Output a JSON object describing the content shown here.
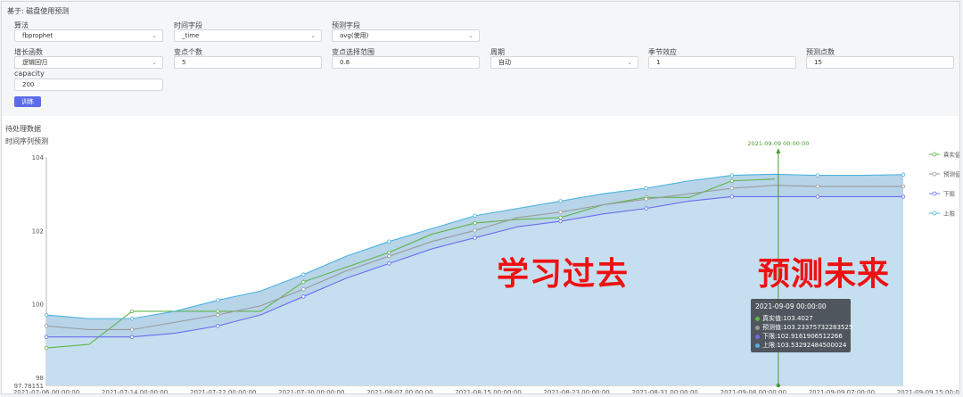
{
  "header": {
    "title": "基于: 磁盘使用预测"
  },
  "form": {
    "algo_label": "算法",
    "algo_value": "fbprophet",
    "time_label": "时间字段",
    "time_value": "_time",
    "pred_label": "预测字段",
    "pred_value": "avg(使用)",
    "growth_label": "增长函数",
    "growth_value": "逻辑回归",
    "cp_count_label": "变点个数",
    "cp_count_value": "5",
    "cp_range_label": "变点选择范围",
    "cp_range_value": "0.8",
    "period_label": "周期",
    "period_value": "自动",
    "season_label": "季节效应",
    "season_value": "1",
    "points_label": "预测点数",
    "points_value": "15",
    "capacity_label": "capacity",
    "capacity_value": "200",
    "train_button": "训练"
  },
  "section": {
    "pending": "待处理数据",
    "ts_title": "时间序列预测"
  },
  "overlay": {
    "learn": "学习过去",
    "predict": "预测未来"
  },
  "tooltip": {
    "time": "2021-09-09 00:00:00",
    "rows": [
      {
        "text": "真实值:103.4027",
        "color": "#5fb548"
      },
      {
        "text": "预测值:103.23375732283525",
        "color": "#9a9a9a"
      },
      {
        "text": "下限:102.9161906512266",
        "color": "#6b6cf0"
      },
      {
        "text": "上限:103.53292484500024",
        "color": "#4bb3e0"
      }
    ]
  },
  "chart_data": {
    "type": "line",
    "x": [
      "2021-07-06",
      "2021-07-10",
      "2021-07-14",
      "2021-07-18",
      "2021-07-22",
      "2021-07-26",
      "2021-07-30",
      "2021-08-03",
      "2021-08-07",
      "2021-08-11",
      "2021-08-15",
      "2021-08-19",
      "2021-08-23",
      "2021-08-27",
      "2021-08-31",
      "2021-09-04",
      "2021-09-08",
      "2021-09-09",
      "2021-09-11",
      "2021-09-13",
      "2021-09-15"
    ],
    "ylim": [
      97.78151,
      104
    ],
    "yticks": [
      "104",
      "102",
      "100",
      "98"
    ],
    "ymin_label": "97.78151",
    "xticks": [
      "2021-07-06 00:00:00",
      "2021-07-14 00:00:00",
      "2021-07-22 00:00:00",
      "2021-07-30 00:00:00",
      "2021-08-07 00:00:00",
      "2021-08-15 00:00:00",
      "2021-08-23 00:00:00",
      "2021-08-31 00:00:00",
      "2021-09-08 00:00:00",
      "2021-09-09 07:00:00",
      "2021-09-09 15:00:00"
    ],
    "marker_label": "2021-09-09 00:00:00",
    "legend_position": "right",
    "series": [
      {
        "name": "真实值",
        "color": "#5fb548",
        "values": [
          98.8,
          98.9,
          99.8,
          99.8,
          99.8,
          99.8,
          100.6,
          101.0,
          101.4,
          101.9,
          102.2,
          102.3,
          102.35,
          102.7,
          102.9,
          102.9,
          103.35,
          103.4,
          null,
          null,
          null
        ]
      },
      {
        "name": "预测值",
        "color": "#9a9a9a",
        "values": [
          99.4,
          99.3,
          99.3,
          99.5,
          99.7,
          99.95,
          100.4,
          100.9,
          101.3,
          101.7,
          102.0,
          102.35,
          102.5,
          102.7,
          102.85,
          103.0,
          103.15,
          103.23,
          103.2,
          103.2,
          103.2
        ]
      },
      {
        "name": "下限",
        "color": "#6b6cf0",
        "values": [
          99.1,
          99.1,
          99.1,
          99.2,
          99.4,
          99.7,
          100.2,
          100.7,
          101.1,
          101.5,
          101.8,
          102.1,
          102.25,
          102.45,
          102.6,
          102.8,
          102.92,
          102.92,
          102.92,
          102.92,
          102.92
        ]
      },
      {
        "name": "上限",
        "color": "#4bb3e0",
        "values": [
          99.7,
          99.6,
          99.6,
          99.8,
          100.1,
          100.35,
          100.8,
          101.3,
          101.7,
          102.05,
          102.4,
          102.6,
          102.8,
          103.0,
          103.15,
          103.35,
          103.5,
          103.53,
          103.5,
          103.5,
          103.52
        ]
      }
    ]
  }
}
